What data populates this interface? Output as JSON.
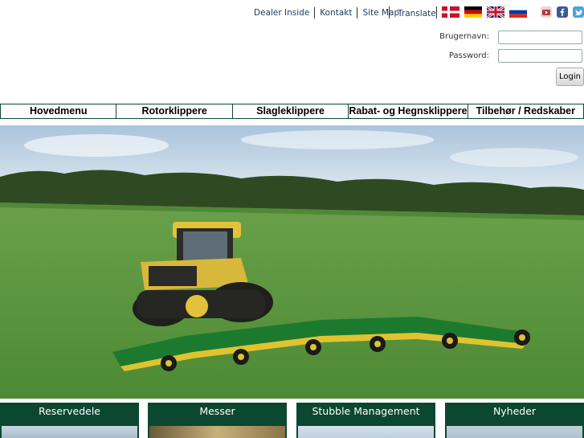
{
  "toplinks": [
    "Dealer Inside",
    "Kontakt",
    "Site Map"
  ],
  "translate_label": "Translate",
  "languages": [
    {
      "name": "danish-flag-icon",
      "colors": [
        "#c8102e",
        "#ffffff"
      ]
    },
    {
      "name": "german-flag-icon",
      "colors": [
        "#000000",
        "#dd0000",
        "#ffce00"
      ]
    },
    {
      "name": "uk-flag-icon",
      "colors": [
        "#012169",
        "#ffffff",
        "#c8102e"
      ]
    },
    {
      "name": "russian-flag-icon",
      "colors": [
        "#ffffff",
        "#0039a6",
        "#d52b1e"
      ]
    }
  ],
  "social": [
    {
      "name": "youtube-icon",
      "color": "#b83a3a"
    },
    {
      "name": "facebook-icon",
      "color": "#3b5998"
    },
    {
      "name": "twitter-icon",
      "color": "#4aa3df"
    }
  ],
  "login": {
    "username_label": "Brugernavn:",
    "password_label": "Password:",
    "username_value": "",
    "password_value": "",
    "button_label": "Login"
  },
  "nav": [
    "Hovedmenu",
    "Rotorklippere",
    "Slagleklippere",
    "Rabat- og Hegnsklippere",
    "Tilbehør / Redskaber"
  ],
  "hero": {
    "icon": "tractor-mower-photo"
  },
  "boxes": [
    "Reservedele",
    "Messer",
    "Stubble Management",
    "Nyheder"
  ],
  "colors": {
    "brand_green": "#0c4731",
    "link": "#1a3a5a"
  }
}
